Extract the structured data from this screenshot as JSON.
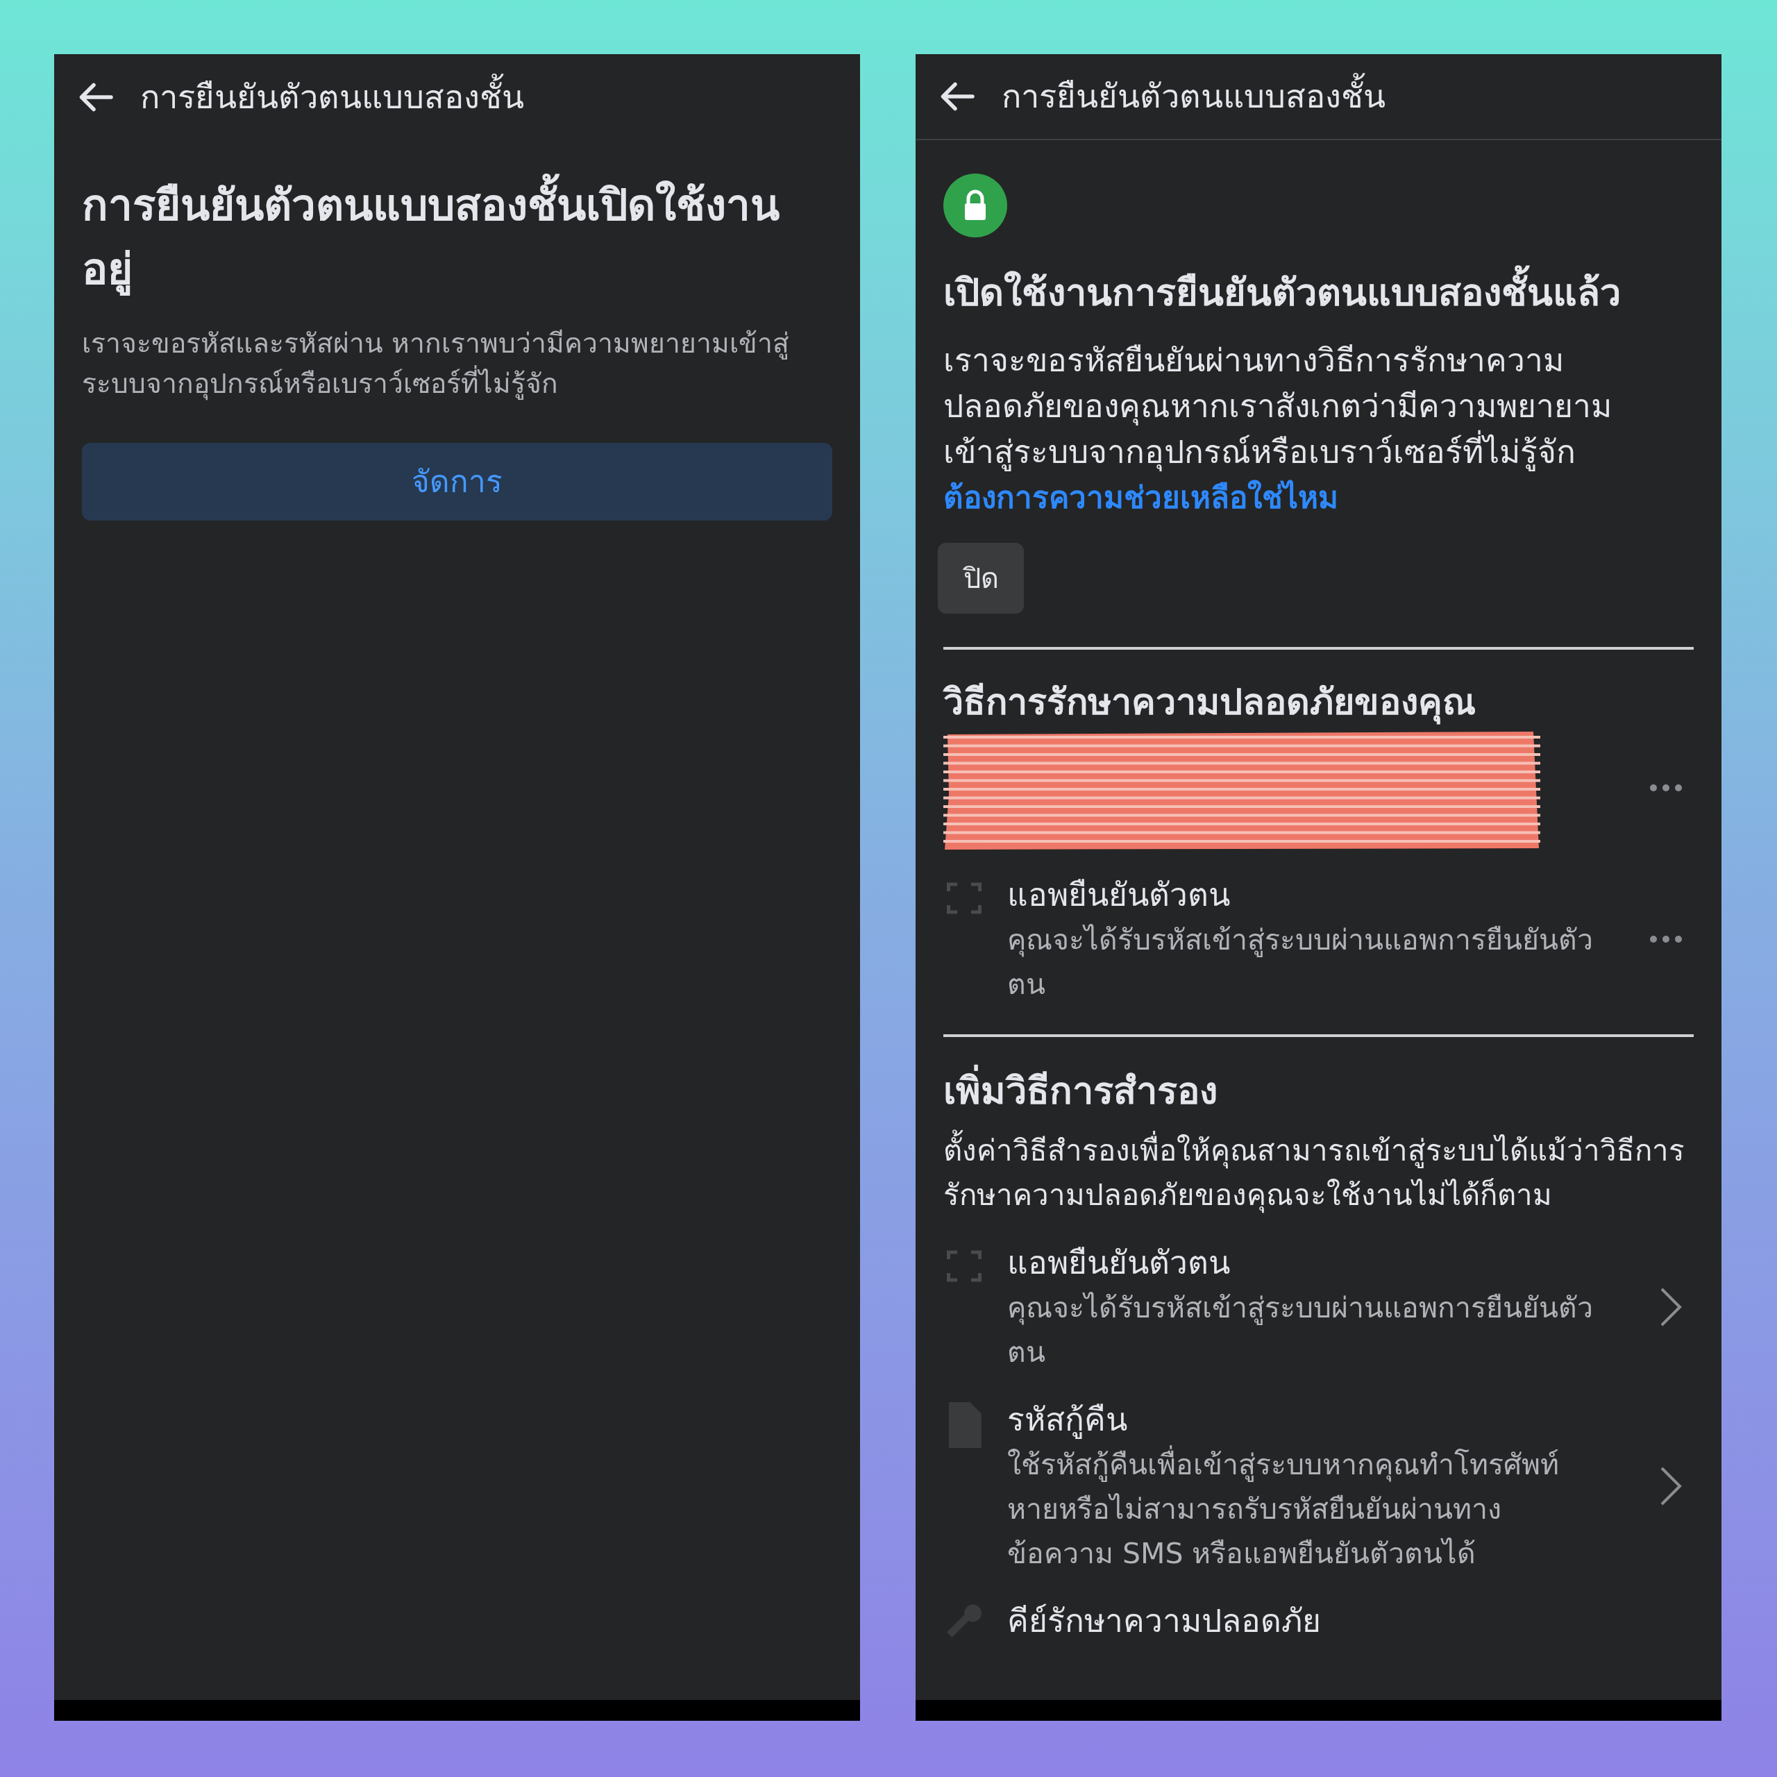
{
  "left_screen": {
    "header": {
      "title": "การยืนยันตัวตนแบบสองชั้น"
    },
    "heading": "การยืนยันตัวตนแบบสองชั้นเปิดใช้งานอยู่",
    "description": "เราจะขอรหัสและรหัสผ่าน หากเราพบว่ามีความพยายามเข้าสู่ระบบจากอุปกรณ์หรือเบราว์เซอร์ที่ไม่รู้จัก",
    "button": "จัดการ"
  },
  "right_screen": {
    "header": {
      "title": "การยืนยันตัวตนแบบสองชั้น"
    },
    "heading": "เปิดใช้งานการยืนยันตัวตนแบบสองชั้นแล้ว",
    "description": "เราจะขอรหัสยืนยันผ่านทางวิธีการรักษาความปลอดภัยของคุณหากเราสังเกตว่ามีความพยายามเข้าสู่ระบบจากอุปกรณ์หรือเบราว์เซอร์ที่ไม่รู้จัก",
    "help_link": "ต้องการความช่วยเหลือใช่ไหม",
    "off_button": "ปิด",
    "methods_section": {
      "title": "วิธีการรักษาความปลอดภัยของคุณ",
      "items": [
        {
          "kind": "redacted"
        },
        {
          "kind": "app",
          "title": "แอพยืนยันตัวตน",
          "subtitle": "คุณจะได้รับรหัสเข้าสู่ระบบผ่านแอพการยืนยันตัวตน"
        }
      ]
    },
    "backup_section": {
      "title": "เพิ่มวิธีการสำรอง",
      "description": "ตั้งค่าวิธีสำรองเพื่อให้คุณสามารถเข้าสู่ระบบได้แม้ว่าวิธีการรักษาความปลอดภัยของคุณจะใช้งานไม่ได้ก็ตาม",
      "items": [
        {
          "kind": "app",
          "title": "แอพยืนยันตัวตน",
          "subtitle": "คุณจะได้รับรหัสเข้าสู่ระบบผ่านแอพการยืนยันตัวตน"
        },
        {
          "kind": "codes",
          "title": "รหัสกู้คืน",
          "subtitle": "ใช้รหัสกู้คืนเพื่อเข้าสู่ระบบหากคุณทำโทรศัพท์หายหรือไม่สามารถรับรหัสยืนยันผ่านทางข้อความ SMS หรือแอพยืนยันตัวตนได้"
        },
        {
          "kind": "key",
          "title": "คีย์รักษาความปลอดภัย"
        }
      ]
    }
  }
}
